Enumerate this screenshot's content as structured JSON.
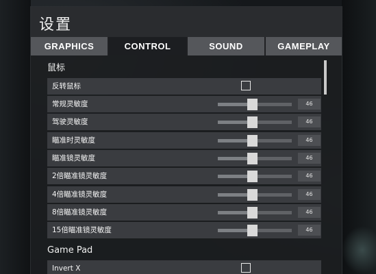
{
  "window": {
    "title": "设置"
  },
  "tabs": [
    {
      "label": "GRAPHICS",
      "active": false
    },
    {
      "label": "CONTROL",
      "active": true
    },
    {
      "label": "SOUND",
      "active": false
    },
    {
      "label": "GAMEPLAY",
      "active": false
    }
  ],
  "sections": {
    "mouse": {
      "title": "鼠标",
      "invert": {
        "label": "反转鼠标",
        "checked": false
      },
      "sliders": [
        {
          "label": "常规灵敏度",
          "value": "46",
          "fraction": 0.46
        },
        {
          "label": "驾驶灵敏度",
          "value": "46",
          "fraction": 0.46
        },
        {
          "label": "瞄准时灵敏度",
          "value": "46",
          "fraction": 0.46
        },
        {
          "label": "瞄准镜灵敏度",
          "value": "46",
          "fraction": 0.46
        },
        {
          "label": "2倍瞄准镜灵敏度",
          "value": "46",
          "fraction": 0.46
        },
        {
          "label": "4倍瞄准镜灵敏度",
          "value": "46",
          "fraction": 0.46
        },
        {
          "label": "8倍瞄准镜灵敏度",
          "value": "46",
          "fraction": 0.46
        },
        {
          "label": "15倍瞄准镜灵敏度",
          "value": "46",
          "fraction": 0.46
        }
      ]
    },
    "gamepad": {
      "title": "Game Pad",
      "invert_x": {
        "label": "Invert X",
        "checked": false
      }
    }
  }
}
